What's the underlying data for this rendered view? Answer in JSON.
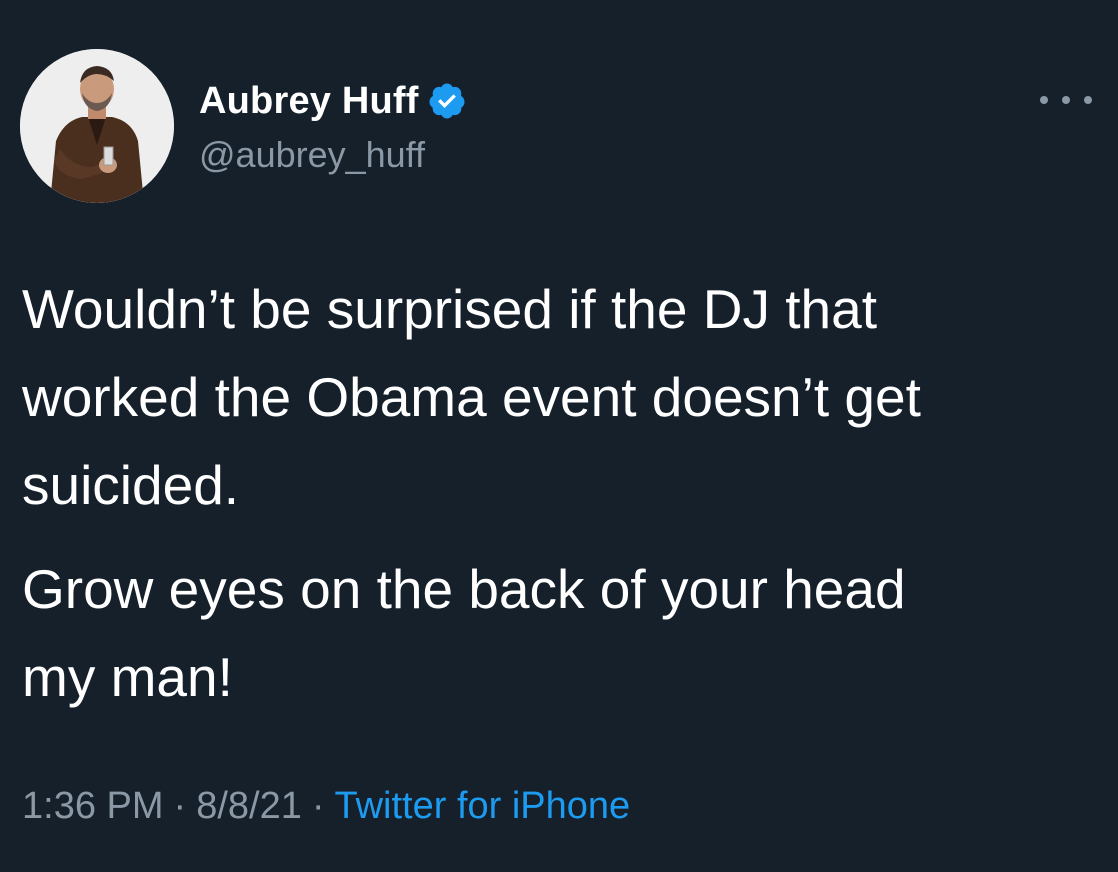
{
  "author": {
    "display_name": "Aubrey Huff",
    "handle": "@aubrey_huff",
    "verified": true
  },
  "tweet": {
    "paragraph_1": "Wouldn’t be surprised if the DJ that\nworked the Obama event doesn’t get\nsuicided.",
    "paragraph_2": "Grow eyes on the back of your head\nmy man!"
  },
  "meta": {
    "time": "1:36 PM",
    "date": "8/8/21",
    "separator": "·",
    "source": "Twitter for iPhone"
  },
  "icons": {
    "verified": "verified-badge-icon",
    "more": "more-options-icon"
  },
  "colors": {
    "background": "#15202b",
    "text_primary": "#ffffff",
    "text_secondary": "#8b98a5",
    "accent": "#1d9bf0"
  }
}
